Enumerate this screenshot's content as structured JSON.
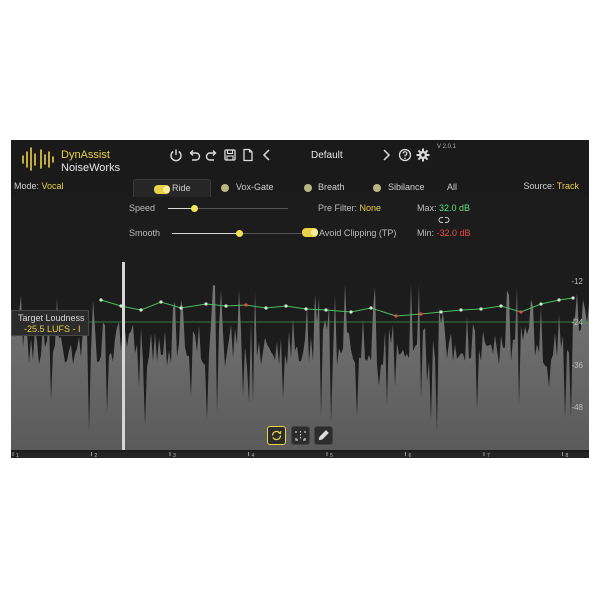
{
  "brand": {
    "line1": "DynAssist",
    "line2": "NoiseWorks"
  },
  "toolbar": {
    "preset": "Default",
    "version": "V 2.0.1"
  },
  "mode": {
    "label": "Mode:",
    "value": "Vocal"
  },
  "source": {
    "label": "Source:",
    "value": "Track"
  },
  "tabs": [
    {
      "label": "Ride",
      "active": true
    },
    {
      "label": "Vox-Gate",
      "active": false
    },
    {
      "label": "Breath",
      "active": false
    },
    {
      "label": "Sibilance",
      "active": false
    },
    {
      "label": "All",
      "active": false
    }
  ],
  "controls": {
    "speed_label": "Speed",
    "speed_value": 0.22,
    "smooth_label": "Smooth",
    "smooth_value": 0.5,
    "prefilter_label": "Pre Filter:",
    "prefilter_value": "None",
    "max_label": "Max:",
    "max_value": "32.0 dB",
    "min_label": "Min:",
    "min_value": "-32.0 dB",
    "avoid_clipping_label": "Avoid Clipping (TP)"
  },
  "target": {
    "label": "Target Loudness",
    "value": "-25.5 LUFS - I"
  },
  "axis": {
    "db_ticks": [
      "-12",
      "-24",
      "-36",
      "-48"
    ],
    "time_ticks": [
      "1",
      "2",
      "3",
      "4",
      "5",
      "6",
      "7",
      "8"
    ]
  },
  "colors": {
    "accent": "#e8d24a",
    "green": "#5fe07c",
    "red": "#ee4848",
    "background": "#1c1c1c"
  },
  "icons": [
    "power-icon",
    "undo-icon",
    "redo-icon",
    "save-icon",
    "new-file-icon",
    "prev-preset-icon",
    "next-preset-icon",
    "help-icon",
    "settings-icon",
    "loop-icon",
    "select-tool-icon",
    "pencil-icon",
    "link-icon"
  ]
}
